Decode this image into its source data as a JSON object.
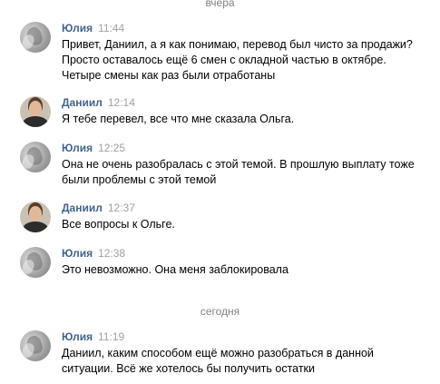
{
  "separators": {
    "yesterday": "вчера",
    "today": "сегодня"
  },
  "messages": [
    {
      "author": "Юлия",
      "time": "11:44",
      "lines": [
        "Привет, Даниил, а я как понимаю, перевод был чисто за продажи?",
        "Просто оставалось ещё 6 смен с окладной частью в октябре.",
        "Четыре смены как раз были отработаны"
      ]
    },
    {
      "author": "Даниил",
      "time": "12:14",
      "lines": [
        "Я тебе перевел, все что мне сказала Ольга."
      ]
    },
    {
      "author": "Юлия",
      "time": "12:25",
      "lines": [
        "Она не очень разобралась с этой темой. В прошлую выплату тоже",
        "были проблемы с этой темой"
      ]
    },
    {
      "author": "Даниил",
      "time": "12:37",
      "lines": [
        "Все вопросы к Ольге."
      ]
    },
    {
      "author": "Юлия",
      "time": "12:38",
      "lines": [
        "Это невозможно. Она меня заблокировала"
      ]
    },
    {
      "author": "Юлия",
      "time": "11:19",
      "lines": [
        "Даниил, каким способом ещё можно разобраться в данной",
        "ситуации. Всё же хотелось бы получить остатки"
      ]
    }
  ]
}
